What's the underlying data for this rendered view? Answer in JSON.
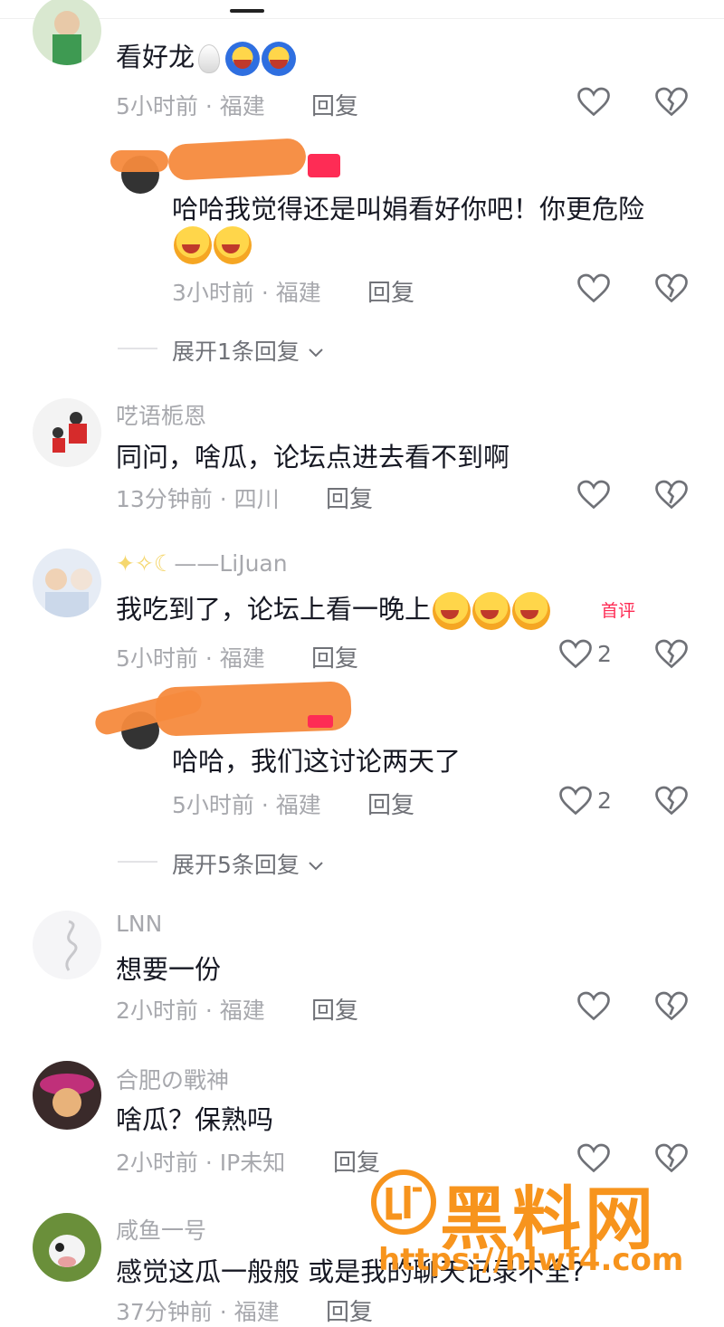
{
  "comments": [
    {
      "username": "",
      "text": "看好龙",
      "time": "5小时前",
      "location": "福建",
      "reply": "回复",
      "likes": ""
    },
    {
      "username": "",
      "text": "哈哈我觉得还是叫娟看好你吧！你更危险",
      "time": "3小时前",
      "location": "福建",
      "reply": "回复",
      "likes": ""
    },
    {
      "username": "呓语栀恩",
      "text": "同问，啥瓜，论坛点进去看不到啊",
      "time": "13分钟前",
      "location": "四川",
      "reply": "回复",
      "likes": ""
    },
    {
      "username": "——LiJuan",
      "text": "我吃到了，论坛上看一晚上",
      "time": "5小时前",
      "location": "福建",
      "reply": "回复",
      "likes": "2",
      "badge": "首评"
    },
    {
      "username": "",
      "text": "哈哈，我们这讨论两天了",
      "time": "5小时前",
      "location": "福建",
      "reply": "回复",
      "likes": "2"
    },
    {
      "username": "LNN",
      "text": "想要一份",
      "time": "2小时前",
      "location": "福建",
      "reply": "回复",
      "likes": ""
    },
    {
      "username": "合肥の戰神",
      "text": "啥瓜？保熟吗",
      "time": "2小时前",
      "location": "IP未知",
      "reply": "回复",
      "likes": ""
    },
    {
      "username": "咸鱼一号",
      "text": "感觉这瓜一般般 或是我的聊天记录不全?",
      "time": "37分钟前",
      "location": "福建",
      "reply": "回复",
      "likes": ""
    }
  ],
  "expand_replies": [
    "展开1条回复",
    "展开5条回复"
  ],
  "separator": "·",
  "watermark": {
    "text": "黑料网",
    "url": "https://hlwf4.com"
  },
  "icons": [
    "heart-icon",
    "dislike-icon",
    "chevron-down-icon",
    "sticker-emoji-icon"
  ],
  "colors": {
    "text": "#161823",
    "meta": "#a7a8ad",
    "badge": "#fe2c55",
    "watermark": "#f7941d",
    "redaction": "#f58a3d"
  }
}
